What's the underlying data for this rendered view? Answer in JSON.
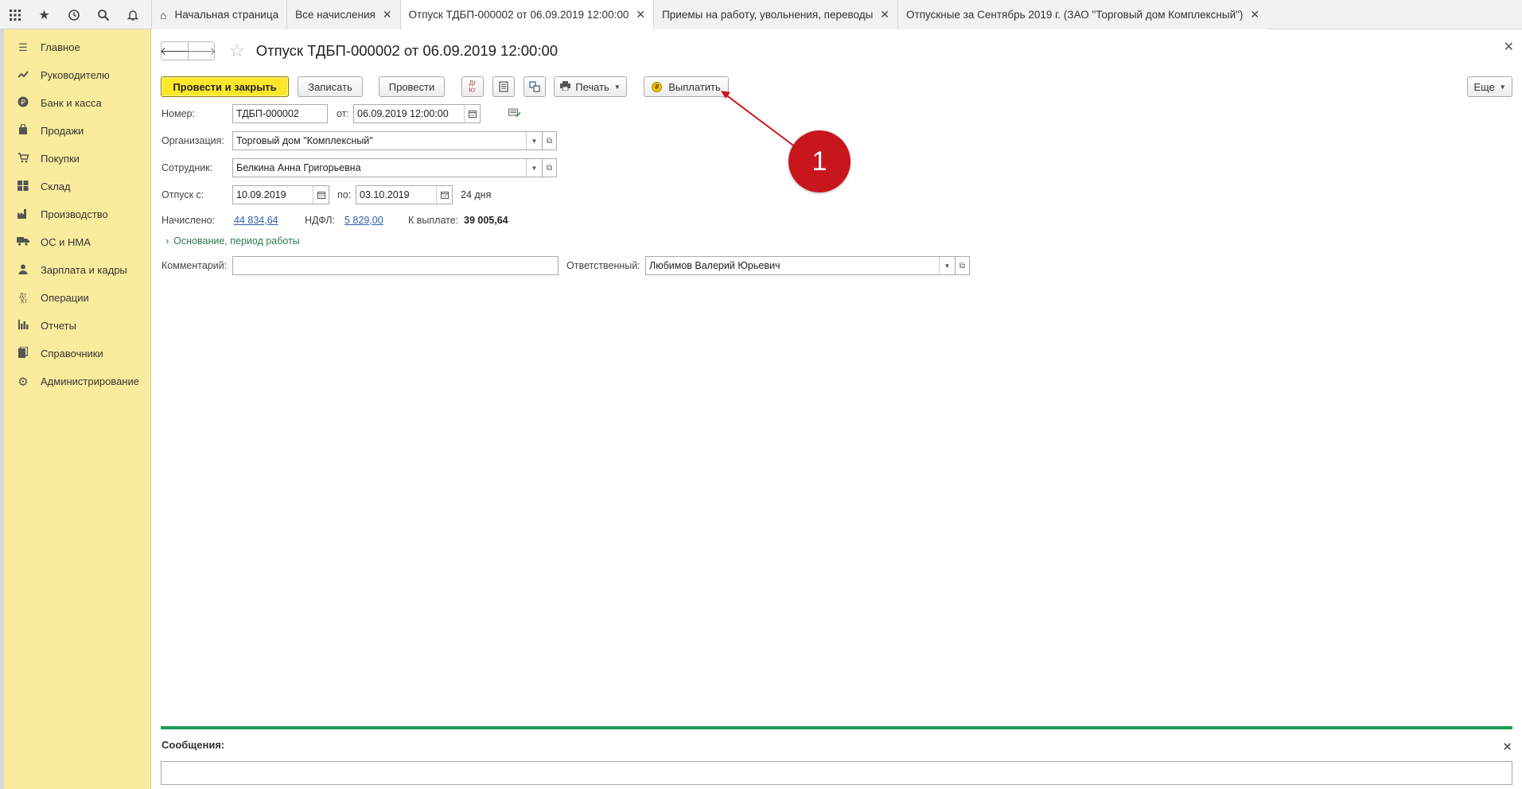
{
  "topbar": {
    "icons": [
      "apps-grid-icon",
      "star-icon",
      "history-icon",
      "search-icon",
      "bell-icon"
    ],
    "tabs": [
      {
        "label": "Начальная страница",
        "active": false,
        "closable": false
      },
      {
        "label": "Все начисления",
        "active": false,
        "closable": true
      },
      {
        "label": "Отпуск ТДБП-000002 от 06.09.2019 12:00:00",
        "active": true,
        "closable": true
      },
      {
        "label": "Приемы на работу, увольнения, переводы",
        "active": false,
        "closable": true
      },
      {
        "label": "Отпускные за Сентябрь 2019 г. (ЗАО \"Торговый дом Комплексный\")",
        "active": false,
        "closable": true
      }
    ]
  },
  "sidebar": {
    "items": [
      {
        "label": "Главное",
        "icon": "menu-lines-icon"
      },
      {
        "label": "Руководителю",
        "icon": "trend-up-icon"
      },
      {
        "label": "Банк и касса",
        "icon": "ruble-coin-icon"
      },
      {
        "label": "Продажи",
        "icon": "shopping-bag-icon"
      },
      {
        "label": "Покупки",
        "icon": "cart-icon"
      },
      {
        "label": "Склад",
        "icon": "warehouse-grid-icon"
      },
      {
        "label": "Производство",
        "icon": "factory-icon"
      },
      {
        "label": "ОС и НМА",
        "icon": "truck-icon"
      },
      {
        "label": "Зарплата и кадры",
        "icon": "person-icon"
      },
      {
        "label": "Операции",
        "icon": "dt-kt-icon"
      },
      {
        "label": "Отчеты",
        "icon": "bar-chart-icon"
      },
      {
        "label": "Справочники",
        "icon": "book-icon"
      },
      {
        "label": "Администрирование",
        "icon": "gear-icon"
      }
    ]
  },
  "document": {
    "title": "Отпуск ТДБП-000002 от 06.09.2019 12:00:00"
  },
  "toolbar": {
    "post_close_label": "Провести и закрыть",
    "save_label": "Записать",
    "post_label": "Провести",
    "print_label": "Печать",
    "pay_label": "Выплатить",
    "more_label": "Еще"
  },
  "form": {
    "number_label": "Номер:",
    "number_value": "ТДБП-000002",
    "date_label": "от:",
    "date_value": "06.09.2019 12:00:00",
    "org_label": "Организация:",
    "org_value": "Торговый дом \"Комплексный\"",
    "employee_label": "Сотрудник:",
    "employee_value": "Белкина Анна Григорьевна",
    "vacation_from_label": "Отпуск с:",
    "vacation_from_value": "10.09.2019",
    "vacation_to_label": "по:",
    "vacation_to_value": "03.10.2019",
    "days_text": "24 дня",
    "accrued_label": "Начислено:",
    "accrued_value": "44 834,64",
    "ndfl_label": "НДФЛ:",
    "ndfl_value": "5 829,00",
    "to_pay_label": "К выплате:",
    "to_pay_value": "39 005,64",
    "basis_expander": "Основание, период работы",
    "comment_label": "Комментарий:",
    "comment_value": "",
    "responsible_label": "Ответственный:",
    "responsible_value": "Любимов Валерий Юрьевич"
  },
  "annotation": {
    "number": "1",
    "color": "#c8161d"
  },
  "messages": {
    "title": "Сообщения:"
  }
}
